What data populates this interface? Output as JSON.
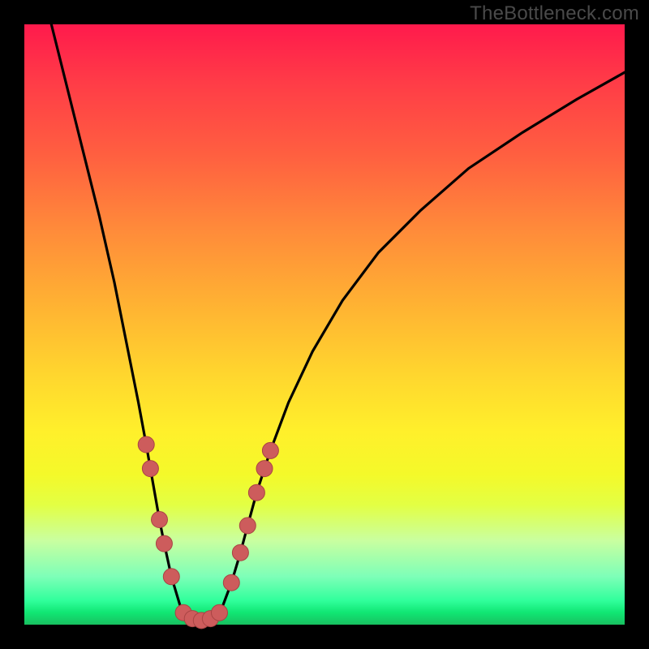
{
  "watermark": "TheBottleneck.com",
  "chart_data": {
    "type": "line",
    "title": "",
    "xlabel": "",
    "ylabel": "",
    "xlim": [
      0,
      100
    ],
    "ylim": [
      0,
      100
    ],
    "grid": false,
    "legend": false,
    "background_gradient": {
      "top_color": "#ff1a4c",
      "mid_color": "#ffd52e",
      "bottom_color": "#18c060"
    },
    "series": [
      {
        "name": "bottleneck-curve",
        "stroke": "#000000",
        "points": [
          {
            "x": 4.5,
            "y": 100.0
          },
          {
            "x": 6.0,
            "y": 94.0
          },
          {
            "x": 8.0,
            "y": 86.0
          },
          {
            "x": 10.0,
            "y": 78.0
          },
          {
            "x": 12.5,
            "y": 68.0
          },
          {
            "x": 15.0,
            "y": 57.0
          },
          {
            "x": 17.0,
            "y": 47.0
          },
          {
            "x": 19.0,
            "y": 37.0
          },
          {
            "x": 20.3,
            "y": 30.0
          },
          {
            "x": 21.0,
            "y": 26.0
          },
          {
            "x": 22.5,
            "y": 17.5
          },
          {
            "x": 23.3,
            "y": 13.5
          },
          {
            "x": 24.5,
            "y": 8.0
          },
          {
            "x": 26.0,
            "y": 3.0
          },
          {
            "x": 27.5,
            "y": 1.0
          },
          {
            "x": 29.5,
            "y": 0.5
          },
          {
            "x": 31.5,
            "y": 1.0
          },
          {
            "x": 33.0,
            "y": 3.0
          },
          {
            "x": 34.5,
            "y": 7.0
          },
          {
            "x": 36.0,
            "y": 12.0
          },
          {
            "x": 37.2,
            "y": 16.5
          },
          {
            "x": 38.7,
            "y": 22.0
          },
          {
            "x": 40.0,
            "y": 26.0
          },
          {
            "x": 41.0,
            "y": 29.0
          },
          {
            "x": 44.0,
            "y": 37.0
          },
          {
            "x": 48.0,
            "y": 45.5
          },
          {
            "x": 53.0,
            "y": 54.0
          },
          {
            "x": 59.0,
            "y": 62.0
          },
          {
            "x": 66.0,
            "y": 69.0
          },
          {
            "x": 74.0,
            "y": 76.0
          },
          {
            "x": 83.0,
            "y": 82.0
          },
          {
            "x": 92.0,
            "y": 87.5
          },
          {
            "x": 100.0,
            "y": 92.0
          }
        ]
      },
      {
        "name": "highlighted-points",
        "type": "scatter",
        "fill": "#cd5c5c",
        "stroke": "#a94444",
        "radius": 10,
        "points": [
          {
            "x": 20.3,
            "y": 30.0
          },
          {
            "x": 21.0,
            "y": 26.0
          },
          {
            "x": 22.5,
            "y": 17.5
          },
          {
            "x": 23.3,
            "y": 13.5
          },
          {
            "x": 24.5,
            "y": 8.0
          },
          {
            "x": 26.5,
            "y": 2.0
          },
          {
            "x": 28.0,
            "y": 1.0
          },
          {
            "x": 29.5,
            "y": 0.7
          },
          {
            "x": 31.0,
            "y": 1.0
          },
          {
            "x": 32.5,
            "y": 2.0
          },
          {
            "x": 34.5,
            "y": 7.0
          },
          {
            "x": 36.0,
            "y": 12.0
          },
          {
            "x": 37.2,
            "y": 16.5
          },
          {
            "x": 38.7,
            "y": 22.0
          },
          {
            "x": 40.0,
            "y": 26.0
          },
          {
            "x": 41.0,
            "y": 29.0
          }
        ]
      }
    ]
  }
}
